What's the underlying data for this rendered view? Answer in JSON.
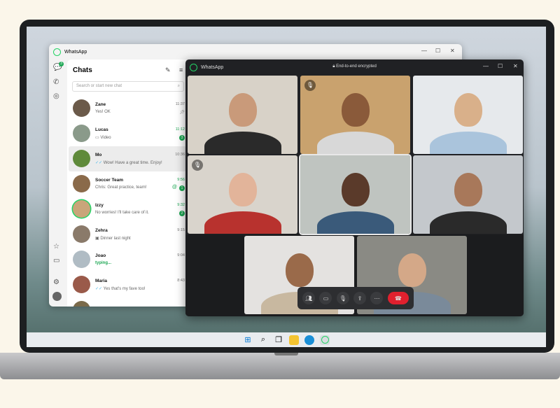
{
  "colors": {
    "accent": "#25d366",
    "badge": "#1fa855",
    "end_call": "#e0202e"
  },
  "main_window": {
    "title": "WhatsApp",
    "nav_badge": "3",
    "chats_title": "Chats",
    "search_placeholder": "Search or start new chat",
    "chats": [
      {
        "name": "Zane",
        "message": "Yes! OK",
        "time": "11:37",
        "badge": null,
        "icon": "pin-icon",
        "color": "#6b5a4a"
      },
      {
        "name": "Lucas",
        "message": "Video",
        "time": "11:12",
        "badge": "3",
        "icon": "video-icon",
        "color": "#8a9a8a"
      },
      {
        "name": "Mo",
        "message": "Wow! Have a great time. Enjoy!",
        "time": "10:36",
        "badge": null,
        "icon": "double-check-icon",
        "color": "#5f8a3a"
      },
      {
        "name": "Soccer Team",
        "message": "Chris: Great practice, team!",
        "time": "9:56",
        "badge": "1",
        "icon": "mention-icon",
        "color": "#8a6a4a"
      },
      {
        "name": "Izzy",
        "message": "No worries! I'll take care of it.",
        "time": "9:32",
        "badge": "2",
        "icon": null,
        "color": "#c9a57a"
      },
      {
        "name": "Zehra",
        "message": "Dinner last night",
        "time": "9:15",
        "badge": null,
        "icon": "photo-icon",
        "color": "#8a7a6a"
      },
      {
        "name": "Joao",
        "message": "typing...",
        "time": "9:04",
        "badge": null,
        "icon": null,
        "color": "#b0bcc4"
      },
      {
        "name": "Maria",
        "message": "Yes that's my fave too!",
        "time": "8:43",
        "badge": null,
        "icon": "double-check-icon",
        "color": "#9a5a4a"
      }
    ]
  },
  "call_window": {
    "title": "WhatsApp",
    "encryption": "End-to-end encrypted",
    "participants": [
      {
        "bg": "#d8d2c8",
        "skin": "#c99a7a",
        "shirt": "#2a2a2a",
        "muted": false
      },
      {
        "bg": "#c9a26e",
        "skin": "#8a5a3a",
        "shirt": "#d8d8d8",
        "muted": true
      },
      {
        "bg": "#e6e9ec",
        "skin": "#d9b08a",
        "shirt": "#aac4dc",
        "muted": false
      },
      {
        "bg": "#d9d4cc",
        "skin": "#e2b49a",
        "shirt": "#b8322e",
        "muted": true
      },
      {
        "bg": "#bfc4c0",
        "skin": "#5a3a2a",
        "shirt": "#3a5a7a",
        "muted": false
      },
      {
        "bg": "#c4c8cc",
        "skin": "#a8785a",
        "shirt": "#2a2a2a",
        "muted": false
      },
      {
        "bg": "#e4e2e0",
        "skin": "#9a6a4a",
        "shirt": "#c8b8a0",
        "muted": false
      },
      {
        "bg": "#8a8a84",
        "skin": "#d4a888",
        "shirt": "#7a8a9a",
        "muted": false
      }
    ],
    "controls": [
      "participants-icon",
      "video-icon",
      "microphone-icon",
      "share-screen-icon",
      "more-icon",
      "end-call-icon"
    ]
  }
}
